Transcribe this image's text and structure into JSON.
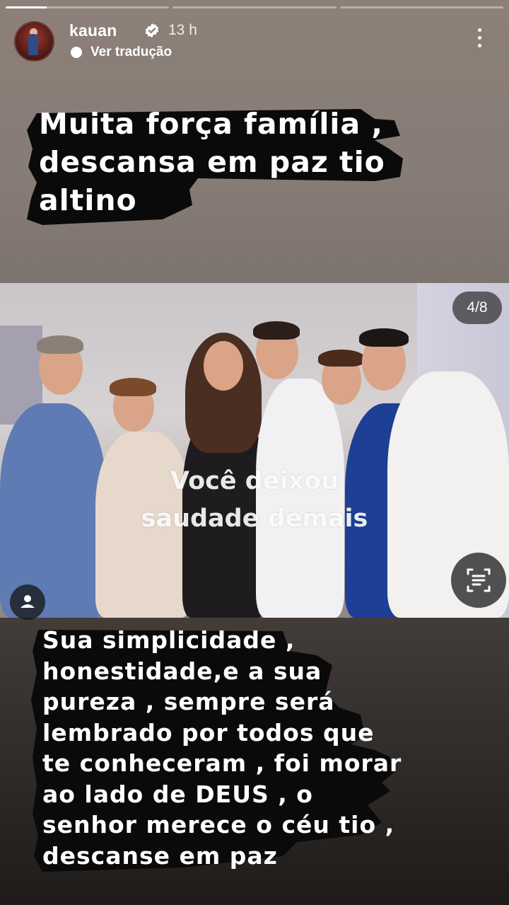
{
  "progress": {
    "segments": 3,
    "active_index": 0,
    "active_fill": 0.25
  },
  "header": {
    "username": "kauan",
    "time": "13 h",
    "translate_label": "Ver tradução"
  },
  "caption_top": {
    "lines": [
      "Muita força família ,",
      "descansa em paz tio",
      "altino"
    ]
  },
  "photo": {
    "counter": "4/8",
    "overlay_lines": [
      "Você deixou",
      "saudade demais"
    ]
  },
  "caption_bottom": {
    "lines": [
      "Sua simplicidade ,",
      "honestidade,e a sua",
      "pureza , sempre será",
      "lembrado por todos que",
      "te conheceram , foi morar",
      "ao lado de DEUS , o",
      "senhor merece o céu tio ,",
      "descanse em paz"
    ]
  },
  "colors": {
    "verified_badge": "#ffffff",
    "brush": "#0b0a0a"
  }
}
